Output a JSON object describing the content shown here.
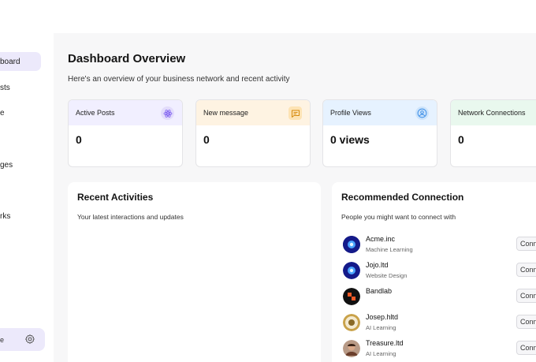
{
  "sidebar": {
    "items": [
      {
        "label": "board"
      },
      {
        "label": "sts"
      },
      {
        "label": "e"
      },
      {
        "label": "ges"
      },
      {
        "label": "rks"
      }
    ],
    "profile_label": "e",
    "settings_icon": "gear-icon"
  },
  "header": {
    "title": "Dashboard Overview",
    "subtitle": "Here's an overview of your business network and recent activity"
  },
  "stats": [
    {
      "label": "Active Posts",
      "value": "0",
      "color": "#f1efff",
      "icon": "atom-icon"
    },
    {
      "label": "New message",
      "value": "0",
      "color": "#fef3e2",
      "icon": "message-icon"
    },
    {
      "label": "Profile Views",
      "value": "0 views",
      "color": "#e6f2ff",
      "icon": "user-circle-icon"
    },
    {
      "label": "Network Connections",
      "value": "0",
      "color": "#e9f8ee",
      "icon": "network-icon"
    }
  ],
  "recent": {
    "title": "Recent Activities",
    "subtitle": "Your latest interactions and updates"
  },
  "recommended": {
    "title": "Recommended Connection",
    "subtitle": "People you might want to connect with",
    "button_label": "Connect",
    "connections": [
      {
        "name": "Acme.inc",
        "role": "Machine Learning"
      },
      {
        "name": "Jojo.ltd",
        "role": "Website Design"
      },
      {
        "name": "Bandlab",
        "role": ""
      },
      {
        "name": "Josep.hltd",
        "role": "AI Learning"
      },
      {
        "name": "Treasure.ltd",
        "role": "AI Learning"
      }
    ]
  }
}
